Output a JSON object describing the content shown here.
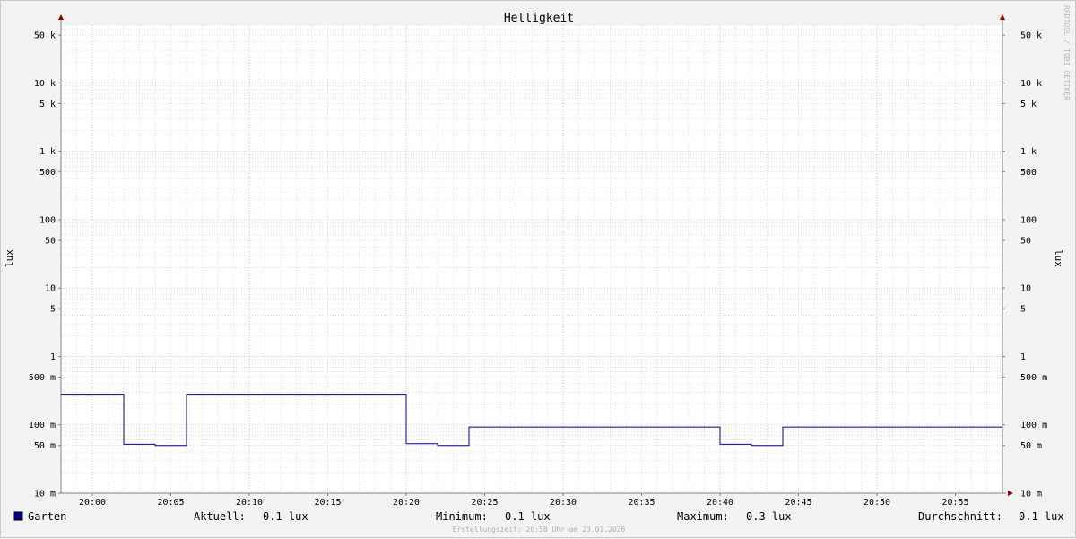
{
  "chart_data": {
    "type": "line",
    "title": "Helligkeit",
    "ylabel_left": "lux",
    "ylabel_right": "lux",
    "y_scale": "log",
    "ylim": [
      0.01,
      70000
    ],
    "y_ticks": [
      {
        "value": 50000,
        "label": "50 k"
      },
      {
        "value": 10000,
        "label": "10 k"
      },
      {
        "value": 5000,
        "label": "5 k"
      },
      {
        "value": 1000,
        "label": "1 k"
      },
      {
        "value": 500,
        "label": "500"
      },
      {
        "value": 100,
        "label": "100"
      },
      {
        "value": 50,
        "label": "50"
      },
      {
        "value": 10,
        "label": "10"
      },
      {
        "value": 5,
        "label": "5"
      },
      {
        "value": 1,
        "label": "1"
      },
      {
        "value": 0.5,
        "label": "500 m"
      },
      {
        "value": 0.1,
        "label": "100 m"
      },
      {
        "value": 0.05,
        "label": "50 m"
      },
      {
        "value": 0.01,
        "label": "10 m"
      }
    ],
    "x_ticks": [
      "20:00",
      "20:05",
      "20:10",
      "20:15",
      "20:20",
      "20:25",
      "20:30",
      "20:35",
      "20:40",
      "20:45",
      "20:50",
      "20:55"
    ],
    "xlim": [
      "19:58",
      "20:58"
    ],
    "grid": true,
    "series": [
      {
        "name": "Garten",
        "color": "#00008b",
        "x": [
          "19:58",
          "20:02",
          "20:02",
          "20:04",
          "20:04",
          "20:06",
          "20:06",
          "20:20",
          "20:20",
          "20:22",
          "20:22",
          "20:24",
          "20:24",
          "20:40",
          "20:40",
          "20:42",
          "20:42",
          "20:44",
          "20:44",
          "20:58"
        ],
        "y": [
          0.28,
          0.28,
          0.052,
          0.052,
          0.05,
          0.05,
          0.28,
          0.28,
          0.053,
          0.053,
          0.05,
          0.05,
          0.093,
          0.093,
          0.052,
          0.052,
          0.05,
          0.05,
          0.093,
          0.093
        ]
      }
    ]
  },
  "legend": {
    "name": "Garten",
    "color": "#00008b",
    "aktuell_label": "Aktuell:",
    "aktuell_value": "0.1 lux",
    "minimum_label": "Minimum:",
    "minimum_value": "0.1 lux",
    "maximum_label": "Maximum:",
    "maximum_value": "0.3 lux",
    "durchschnitt_label": "Durchschnitt:",
    "durchschnitt_value": "0.1 lux"
  },
  "footer": "Erstellungszeit: 20:58 Uhr am 23.01.2026",
  "watermark": "RRDTOOL / TOBI OETIKER",
  "colors": {
    "background": "#f3f3f3",
    "plot": "#ffffff",
    "major_grid": "#e6a0a0",
    "minor_grid": "#c8c8c8",
    "axis": "#808080",
    "arrow": "#990000"
  }
}
